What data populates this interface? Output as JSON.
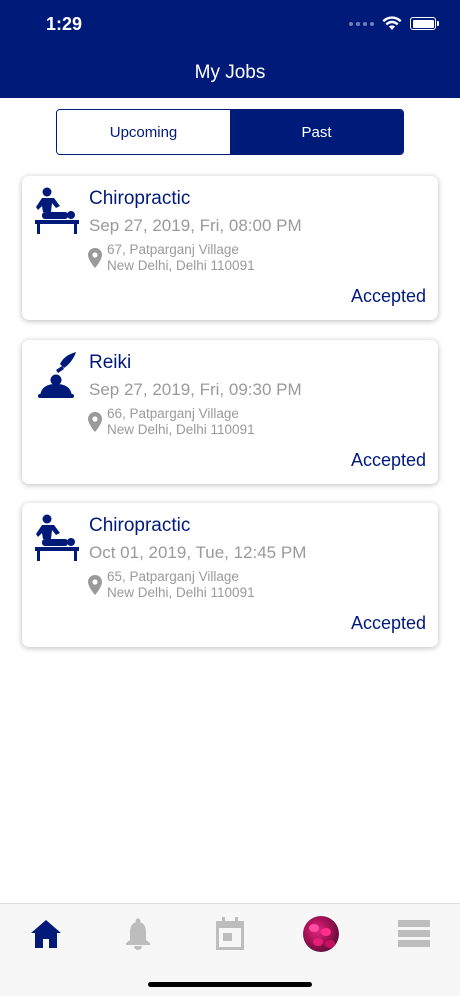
{
  "status_bar": {
    "time": "1:29"
  },
  "header": {
    "title": "My Jobs"
  },
  "segments": [
    {
      "label": "Upcoming",
      "active": false
    },
    {
      "label": "Past",
      "active": true
    }
  ],
  "jobs": [
    {
      "service": "Chiropractic",
      "icon": "chiropractic-icon",
      "date": "Sep 27, 2019, Fri, 08:00 PM",
      "address_line1": "67, Patparganj Village",
      "address_line2": "New Delhi, Delhi 110091",
      "status": "Accepted"
    },
    {
      "service": "Reiki",
      "icon": "reiki-icon",
      "date": "Sep 27, 2019, Fri, 09:30 PM",
      "address_line1": "66, Patparganj Village",
      "address_line2": "New Delhi, Delhi 110091",
      "status": "Accepted"
    },
    {
      "service": "Chiropractic",
      "icon": "chiropractic-icon",
      "date": "Oct 01, 2019, Tue, 12:45 PM",
      "address_line1": "65, Patparganj Village",
      "address_line2": "New Delhi, Delhi 110091",
      "status": "Accepted"
    }
  ],
  "tab_bar": [
    {
      "icon": "home-icon",
      "active": true
    },
    {
      "icon": "bell-icon",
      "active": false
    },
    {
      "icon": "calendar-icon",
      "active": false
    },
    {
      "icon": "profile-avatar",
      "active": false
    },
    {
      "icon": "menu-icon",
      "active": false
    }
  ],
  "colors": {
    "primary": "#001a7a",
    "muted": "#9a9a9a",
    "inactive_icon": "#bdbdbd"
  }
}
